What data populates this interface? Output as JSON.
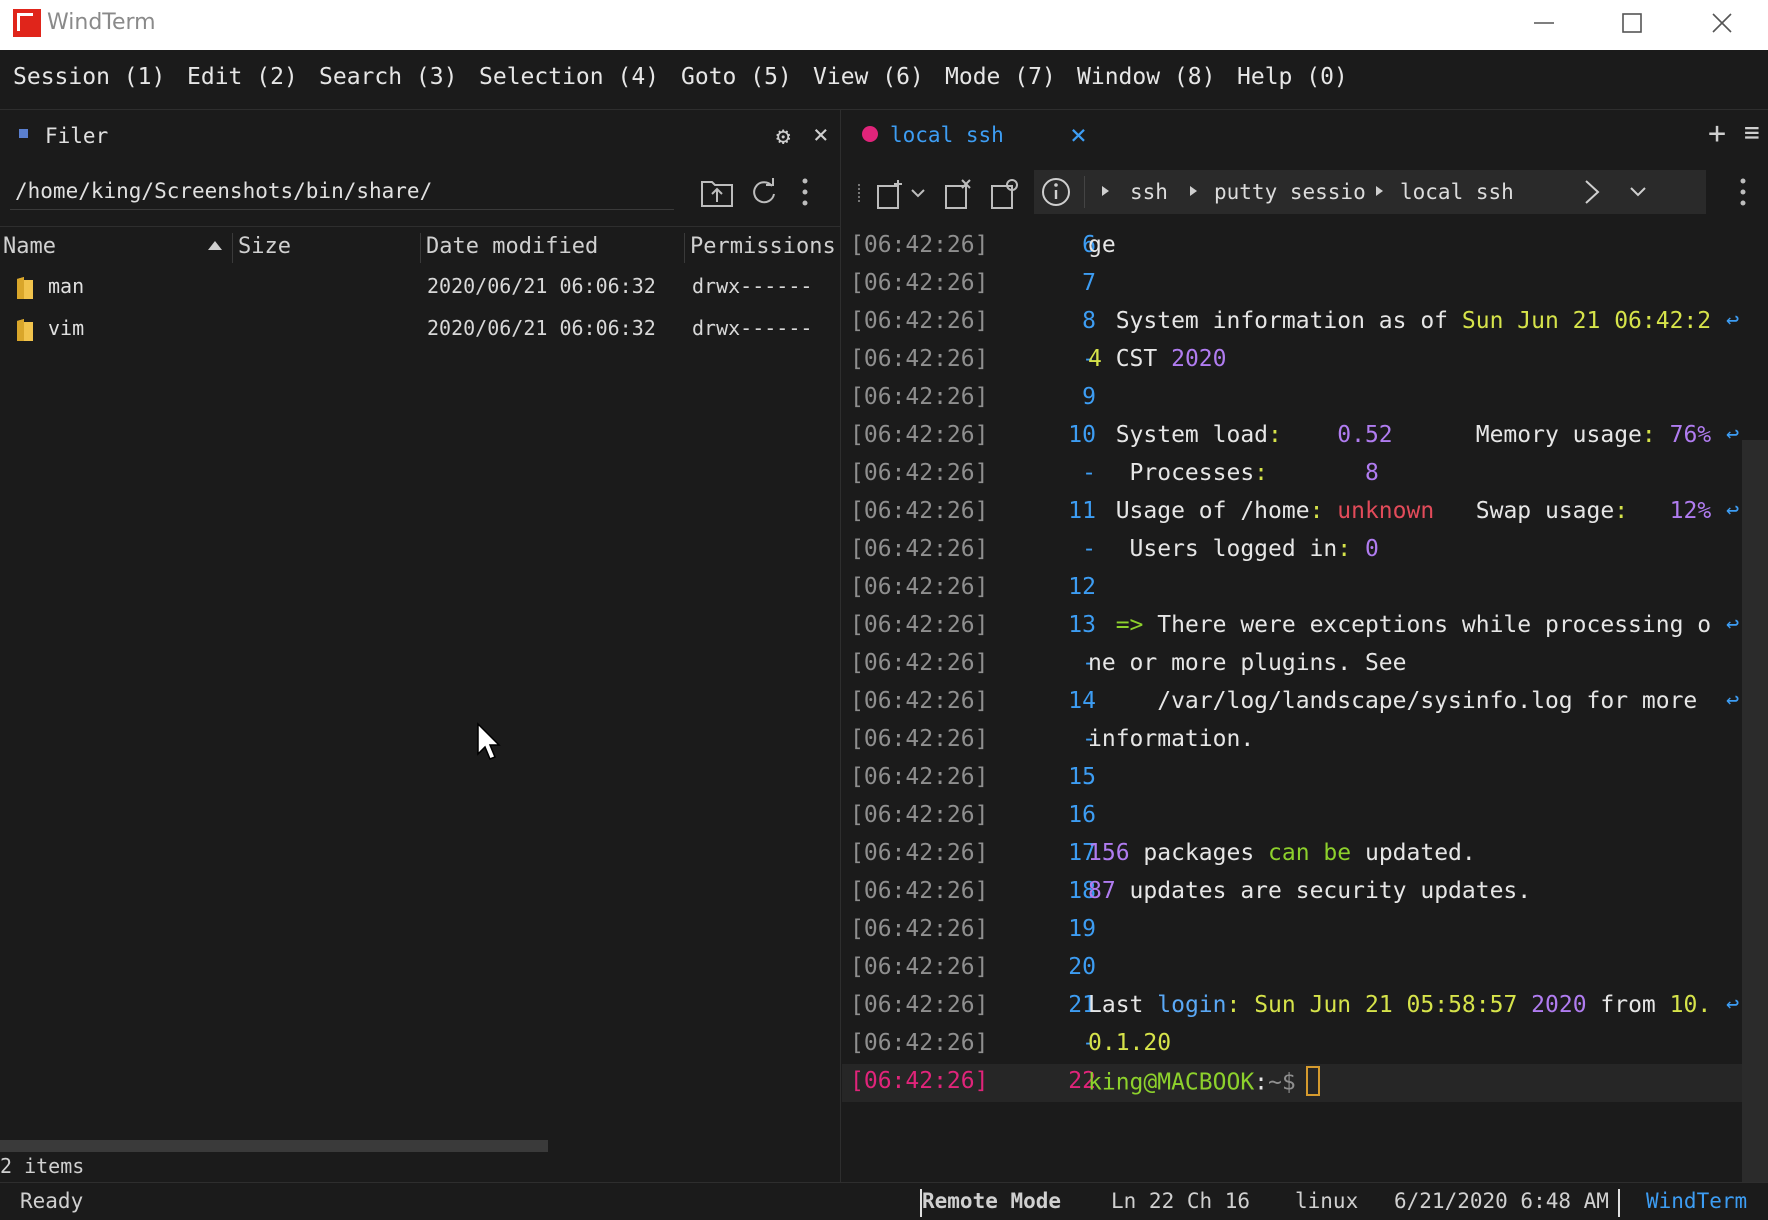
{
  "window": {
    "title": "WindTerm",
    "brand_color": "#e0251b"
  },
  "menu": [
    {
      "label": "Session (1)"
    },
    {
      "label": "Edit (2)"
    },
    {
      "label": "Search (3)"
    },
    {
      "label": "Selection (4)"
    },
    {
      "label": "Goto (5)"
    },
    {
      "label": "View (6)"
    },
    {
      "label": "Mode (7)"
    },
    {
      "label": "Window (8)"
    },
    {
      "label": "Help (0)"
    }
  ],
  "filer": {
    "title": "Filer",
    "path": "/home/king/Screenshots/bin/share/",
    "columns": [
      "Name",
      "Size",
      "Date modified",
      "Permissions"
    ],
    "rows": [
      {
        "name": "man",
        "size": "",
        "date": "2020/06/21 06:06:32",
        "perm": "drwx------"
      },
      {
        "name": "vim",
        "size": "",
        "date": "2020/06/21 06:06:32",
        "perm": "drwx------"
      }
    ],
    "items_count": "2 items"
  },
  "terminal": {
    "tab_label": "local ssh",
    "tab_dot_color": "#e0247a",
    "breadcrumb": [
      "ssh",
      "putty sessio",
      "local ssh"
    ],
    "lines": [
      {
        "ts": "[06:42:26]",
        "ln": "6",
        "segs": [
          {
            "t": "ge",
            "c": "white"
          }
        ]
      },
      {
        "ts": "[06:42:26]",
        "ln": "7",
        "segs": []
      },
      {
        "ts": "[06:42:26]",
        "ln": "8",
        "wrap": true,
        "segs": [
          {
            "t": "  System information as of ",
            "c": "white"
          },
          {
            "t": "Sun Jun 21 06:42:2",
            "c": "yellow"
          }
        ]
      },
      {
        "ts": "[06:42:26]",
        "ln": "-",
        "segs": [
          {
            "t": "4 ",
            "c": "yellow"
          },
          {
            "t": "CST ",
            "c": "white"
          },
          {
            "t": "2020",
            "c": "purple"
          }
        ]
      },
      {
        "ts": "[06:42:26]",
        "ln": "9",
        "segs": []
      },
      {
        "ts": "[06:42:26]",
        "ln": "10",
        "wrap": true,
        "segs": [
          {
            "t": "  System load",
            "c": "white"
          },
          {
            "t": ":",
            "c": "yellow"
          },
          {
            "t": "    0.52",
            "c": "purple"
          },
          {
            "t": "      Memory usage",
            "c": "white"
          },
          {
            "t": ":",
            "c": "yellow"
          },
          {
            "t": " 76%",
            "c": "purple"
          }
        ]
      },
      {
        "ts": "[06:42:26]",
        "ln": "-",
        "segs": [
          {
            "t": "   Processes",
            "c": "white"
          },
          {
            "t": ":",
            "c": "yellow"
          },
          {
            "t": "       8",
            "c": "purple"
          }
        ]
      },
      {
        "ts": "[06:42:26]",
        "ln": "11",
        "wrap": true,
        "segs": [
          {
            "t": "  Usage of /home",
            "c": "white"
          },
          {
            "t": ": ",
            "c": "yellow"
          },
          {
            "t": "unknown",
            "c": "red"
          },
          {
            "t": "   Swap usage",
            "c": "white"
          },
          {
            "t": ":",
            "c": "yellow"
          },
          {
            "t": "   12%",
            "c": "purple"
          }
        ]
      },
      {
        "ts": "[06:42:26]",
        "ln": "-",
        "segs": [
          {
            "t": "   Users logged in",
            "c": "white"
          },
          {
            "t": ": ",
            "c": "yellow"
          },
          {
            "t": "0",
            "c": "purple"
          }
        ]
      },
      {
        "ts": "[06:42:26]",
        "ln": "12",
        "segs": []
      },
      {
        "ts": "[06:42:26]",
        "ln": "13",
        "wrap": true,
        "segs": [
          {
            "t": "  => ",
            "c": "green"
          },
          {
            "t": "There were exceptions while processing o",
            "c": "white"
          }
        ]
      },
      {
        "ts": "[06:42:26]",
        "ln": "-",
        "segs": [
          {
            "t": "ne or more plugins. See",
            "c": "white"
          }
        ]
      },
      {
        "ts": "[06:42:26]",
        "ln": "14",
        "wrap": true,
        "segs": [
          {
            "t": "     /var/log/landscape/sysinfo.log for more ",
            "c": "white"
          }
        ]
      },
      {
        "ts": "[06:42:26]",
        "ln": "-",
        "segs": [
          {
            "t": "information.",
            "c": "white"
          }
        ]
      },
      {
        "ts": "[06:42:26]",
        "ln": "15",
        "segs": []
      },
      {
        "ts": "[06:42:26]",
        "ln": "16",
        "segs": []
      },
      {
        "ts": "[06:42:26]",
        "ln": "17",
        "segs": [
          {
            "t": "156",
            "c": "purple"
          },
          {
            "t": " packages ",
            "c": "white"
          },
          {
            "t": "can be",
            "c": "green"
          },
          {
            "t": " updated.",
            "c": "white"
          }
        ]
      },
      {
        "ts": "[06:42:26]",
        "ln": "18",
        "segs": [
          {
            "t": "87",
            "c": "purple"
          },
          {
            "t": " updates are security updates.",
            "c": "white"
          }
        ]
      },
      {
        "ts": "[06:42:26]",
        "ln": "19",
        "segs": []
      },
      {
        "ts": "[06:42:26]",
        "ln": "20",
        "segs": []
      },
      {
        "ts": "[06:42:26]",
        "ln": "21",
        "wrap": true,
        "segs": [
          {
            "t": "Last ",
            "c": "white"
          },
          {
            "t": "login",
            "c": "blue"
          },
          {
            "t": ": ",
            "c": "yellow"
          },
          {
            "t": "Sun Jun 21 05:58:57 ",
            "c": "yellow"
          },
          {
            "t": "2020",
            "c": "purple"
          },
          {
            "t": " from ",
            "c": "white"
          },
          {
            "t": "10.",
            "c": "yellow"
          }
        ]
      },
      {
        "ts": "[06:42:26]",
        "ln": "-",
        "segs": [
          {
            "t": "0.1.20",
            "c": "yellow"
          }
        ]
      },
      {
        "ts": "[06:42:26]",
        "ln": "22",
        "current": true,
        "segs": [
          {
            "t": "king@MACBOOK",
            "c": "prompt"
          },
          {
            "t": ":",
            "c": "white"
          },
          {
            "t": "~$",
            "c": "dim"
          }
        ]
      }
    ]
  },
  "status": {
    "ready": "Ready",
    "mode": "Remote Mode",
    "position": "Ln 22 Ch 16",
    "os": "linux",
    "datetime": "6/21/2020 6:48 AM",
    "app": "WindTerm",
    "accent": "#3d9df3"
  }
}
